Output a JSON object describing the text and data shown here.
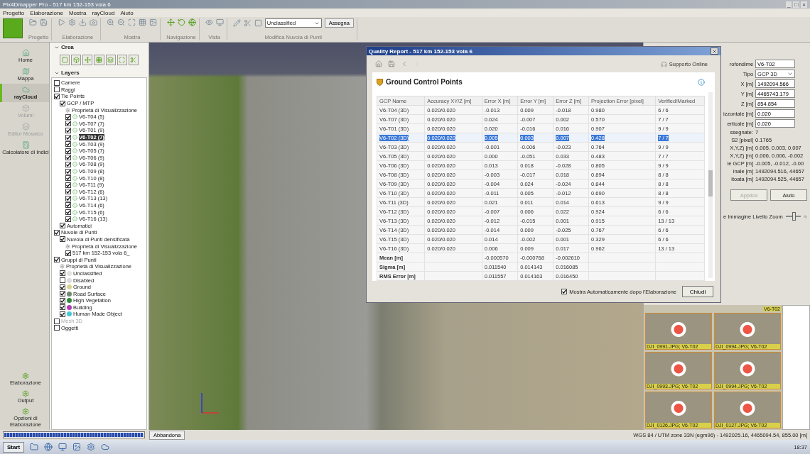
{
  "window": {
    "title": "Pix4Dmapper Pro - 517 km 152-153 vola 6",
    "controls": [
      "_",
      "□",
      "×"
    ]
  },
  "menu": [
    "Progetto",
    "Elaborazione",
    "Mostra",
    "rayCloud",
    "Aiuto"
  ],
  "toolbar": {
    "groups": [
      {
        "label": "Progetto"
      },
      {
        "label": "Elaborazione"
      },
      {
        "label": "Mostra"
      },
      {
        "label": "Navigazione"
      },
      {
        "label": "Vista"
      },
      {
        "label": "Modifica Nuvola di Punti"
      }
    ],
    "class_select": "Unclassified",
    "assign_button": "Assegna"
  },
  "nav": {
    "items": [
      {
        "label": "Home",
        "selected": false,
        "disabled": false
      },
      {
        "label": "Mappa",
        "selected": false,
        "disabled": false
      },
      {
        "label": "rayCloud",
        "selected": true,
        "disabled": false
      },
      {
        "label": "Volumi",
        "selected": false,
        "disabled": true
      },
      {
        "label": "Editor Mosaico",
        "selected": false,
        "disabled": true
      },
      {
        "label": "Calcolatore di Indici",
        "selected": false,
        "disabled": false
      }
    ],
    "bottom": [
      "Elaborazione",
      "Output",
      "Opzioni di Elaborazione"
    ]
  },
  "create": {
    "title": "Crea"
  },
  "layers": {
    "title": "Layers",
    "tree": [
      {
        "label": "Camere",
        "kind": "layer",
        "checked": false
      },
      {
        "label": "Raggi",
        "kind": "layer",
        "checked": false
      },
      {
        "label": "Tie Points",
        "kind": "layer",
        "checked": true,
        "children": [
          {
            "label": "GCP / MTP",
            "kind": "layer",
            "checked": true,
            "children": [
              {
                "label": "Proprietà di Visualizzazione",
                "kind": "props"
              },
              {
                "label": "V6-T04 (5)",
                "kind": "point",
                "checked": true,
                "selected": false
              },
              {
                "label": "V6-T07 (7)",
                "kind": "point",
                "checked": true,
                "selected": false
              },
              {
                "label": "V6-T01 (9)",
                "kind": "point",
                "checked": true,
                "selected": false
              },
              {
                "label": "V6-T02 (7)",
                "kind": "point",
                "checked": true,
                "selected": true
              },
              {
                "label": "V6-T03 (9)",
                "kind": "point",
                "checked": true,
                "selected": false
              },
              {
                "label": "V6-T05 (7)",
                "kind": "point",
                "checked": true,
                "selected": false
              },
              {
                "label": "V6-T06 (9)",
                "kind": "point",
                "checked": true,
                "selected": false
              },
              {
                "label": "V6-T08 (9)",
                "kind": "point",
                "checked": true,
                "selected": false
              },
              {
                "label": "V6-T09 (8)",
                "kind": "point",
                "checked": true,
                "selected": false
              },
              {
                "label": "V6-T10 (8)",
                "kind": "point",
                "checked": true,
                "selected": false
              },
              {
                "label": "V6-T11 (9)",
                "kind": "point",
                "checked": true,
                "selected": false
              },
              {
                "label": "V6-T12 (6)",
                "kind": "point",
                "checked": true,
                "selected": false
              },
              {
                "label": "V6-T13 (13)",
                "kind": "point",
                "checked": true,
                "selected": false
              },
              {
                "label": "V6-T14 (6)",
                "kind": "point",
                "checked": true,
                "selected": false
              },
              {
                "label": "V6-T15 (6)",
                "kind": "point",
                "checked": true,
                "selected": false
              },
              {
                "label": "V6-T16 (13)",
                "kind": "point",
                "checked": true,
                "selected": false
              }
            ]
          },
          {
            "label": "Automatici",
            "kind": "layer",
            "checked": true
          }
        ]
      },
      {
        "label": "Nuvole di Punti",
        "kind": "layer",
        "checked": true,
        "children": [
          {
            "label": "Nuvola di Punti densificata",
            "kind": "layer",
            "checked": true,
            "children": [
              {
                "label": "Proprietà di Visualizzazione",
                "kind": "props"
              },
              {
                "label": "517 km 152-153 vola 6_",
                "kind": "layer",
                "checked": true
              }
            ]
          }
        ]
      },
      {
        "label": "Gruppi di Punti",
        "kind": "layer",
        "checked": true,
        "children": [
          {
            "label": "Proprietà di Visualizzazione",
            "kind": "props"
          },
          {
            "label": "Unclassified",
            "kind": "class",
            "checked": true,
            "color": "#e4e4dc"
          },
          {
            "label": "Disabled",
            "kind": "class",
            "checked": false,
            "color": "#dcdcdc"
          },
          {
            "label": "Ground",
            "kind": "class",
            "checked": true,
            "color": "#d8d490"
          },
          {
            "label": "Road Surface",
            "kind": "class",
            "checked": true,
            "color": "#6f8a6f"
          },
          {
            "label": "High Vegetation",
            "kind": "class",
            "checked": true,
            "color": "#2f8a3a"
          },
          {
            "label": "Building",
            "kind": "class",
            "checked": true,
            "color": "#b03cb8"
          },
          {
            "label": "Human Made Object",
            "kind": "class",
            "checked": true,
            "color": "#45c8d8"
          }
        ]
      },
      {
        "label": "Mesh 3D",
        "kind": "layer",
        "checked": false,
        "disabled": true
      },
      {
        "label": "Oggetti",
        "kind": "layer",
        "checked": false,
        "disabled": false
      }
    ]
  },
  "report": {
    "title": "Quality Report - 517 km 152-153 vola 6",
    "support": "Supporto Online",
    "section": "Ground Control Points",
    "table": {
      "columns": [
        "GCP Name",
        "Accuracy XY/Z [m]",
        "Error X [m]",
        "Error Y [m]",
        "Error Z [m]",
        "Projection Error [pixel]",
        "Verified/Marked"
      ],
      "rows": [
        {
          "kind": "gcp",
          "cells": [
            "V6-T04 (3D)",
            "0.020/0.020",
            "-0.013",
            "0.009",
            "-0.018",
            "0.980",
            "6 / 6"
          ],
          "selected": false
        },
        {
          "kind": "gcp",
          "cells": [
            "V6-T07 (3D)",
            "0.020/0.020",
            "0.024",
            "-0.007",
            "0.002",
            "0.570",
            "7 / 7"
          ],
          "selected": false
        },
        {
          "kind": "gcp",
          "cells": [
            "V6-T01 (3D)",
            "0.020/0.020",
            "0.020",
            "-0.016",
            "0.016",
            "0.907",
            "9 / 9"
          ],
          "selected": false
        },
        {
          "kind": "gcp",
          "cells": [
            "V6-T02 (3D)",
            "0.020/0.020",
            "0.005",
            "0.003",
            "0.007",
            "0.428",
            "7 / 7"
          ],
          "selected": true
        },
        {
          "kind": "gcp",
          "cells": [
            "V6-T03 (3D)",
            "0.020/0.020",
            "-0.001",
            "-0.006",
            "-0.023",
            "0.764",
            "9 / 9"
          ],
          "selected": false
        },
        {
          "kind": "gcp",
          "cells": [
            "V6-T05 (3D)",
            "0.020/0.020",
            "0.000",
            "-0.051",
            "0.033",
            "0.483",
            "7 / 7"
          ],
          "selected": false
        },
        {
          "kind": "gcp",
          "cells": [
            "V6-T06 (3D)",
            "0.020/0.020",
            "0.013",
            "0.018",
            "-0.028",
            "0.805",
            "9 / 9"
          ],
          "selected": false
        },
        {
          "kind": "gcp",
          "cells": [
            "V6-T08 (3D)",
            "0.020/0.020",
            "-0.003",
            "-0.017",
            "0.018",
            "0.894",
            "8 / 8"
          ],
          "selected": false
        },
        {
          "kind": "gcp",
          "cells": [
            "V6-T09 (3D)",
            "0.020/0.020",
            "-0.004",
            "0.024",
            "-0.024",
            "0.844",
            "8 / 8"
          ],
          "selected": false
        },
        {
          "kind": "gcp",
          "cells": [
            "V6-T10 (3D)",
            "0.020/0.020",
            "-0.011",
            "0.005",
            "-0.012",
            "0.690",
            "8 / 8"
          ],
          "selected": false
        },
        {
          "kind": "gcp",
          "cells": [
            "V6-T11 (3D)",
            "0.020/0.020",
            "0.021",
            "0.011",
            "0.014",
            "0.613",
            "9 / 9"
          ],
          "selected": false
        },
        {
          "kind": "gcp",
          "cells": [
            "V6-T12 (3D)",
            "0.020/0.020",
            "-0.007",
            "0.006",
            "0.022",
            "0.924",
            "6 / 6"
          ],
          "selected": false
        },
        {
          "kind": "gcp",
          "cells": [
            "V6-T13 (3D)",
            "0.020/0.020",
            "-0.012",
            "-0.015",
            "0.001",
            "0.915",
            "13 / 13"
          ],
          "selected": false
        },
        {
          "kind": "gcp",
          "cells": [
            "V6-T14 (3D)",
            "0.020/0.020",
            "-0.014",
            "0.009",
            "-0.025",
            "0.767",
            "6 / 6"
          ],
          "selected": false
        },
        {
          "kind": "gcp",
          "cells": [
            "V6-T15 (3D)",
            "0.020/0.020",
            "0.014",
            "-0.002",
            "0.001",
            "0.329",
            "6 / 6"
          ],
          "selected": false
        },
        {
          "kind": "gcp",
          "cells": [
            "V6-T16 (3D)",
            "0.020/0.020",
            "0.006",
            "0.009",
            "0.017",
            "0.962",
            "13 / 13"
          ],
          "selected": false
        },
        {
          "kind": "summary",
          "cells": [
            "Mean [m]",
            "-0.000570",
            "-0.000768",
            "-0.002610"
          ],
          "selected": false
        },
        {
          "kind": "summary",
          "cells": [
            "Sigma [m]",
            "0.011540",
            "0.014143",
            "0.016085"
          ],
          "selected": false
        },
        {
          "kind": "summary",
          "cells": [
            "RMS Error [m]",
            "0.011557",
            "0.014163",
            "0.016450"
          ],
          "selected": false
        }
      ]
    },
    "auto_show": {
      "label": "Mostra Automaticamente dopo l'Elaborazione",
      "checked": true
    },
    "close_button": "Chiudi"
  },
  "properties": {
    "fields": [
      {
        "label": "rofondime",
        "kind": "input",
        "value": "V6-T02"
      },
      {
        "label": "Tipo",
        "kind": "select",
        "value": "GCP 3D"
      },
      {
        "label": "X [m]",
        "kind": "input",
        "value": "1492094.566"
      },
      {
        "label": "Y [m]",
        "kind": "input",
        "value": "4465743.179"
      },
      {
        "label": "Z [m]",
        "kind": "input",
        "value": "854.854"
      },
      {
        "label": "izzontale [m]",
        "kind": "input",
        "value": "0.020"
      },
      {
        "label": "erticale [m]",
        "kind": "input",
        "value": "0.020"
      },
      {
        "label": "ssegnate:",
        "kind": "text",
        "value": "7"
      },
      {
        "label": "S2 [pixel]",
        "kind": "text",
        "value": "0.1765"
      },
      {
        "label": "X,Y,Z) [m]",
        "kind": "text",
        "value": "0.005, 0.003, 0.007"
      },
      {
        "label": "X,Y,Z) [m]",
        "kind": "text",
        "value": "0.006, 0.006, -0.002"
      },
      {
        "label": "le GCP [m]",
        "kind": "text",
        "value": "-0.005, -0.012, -0.00"
      },
      {
        "label": "inale [m]",
        "kind": "text",
        "value": "1492094.516, 44657"
      },
      {
        "label": "itoata [m]",
        "kind": "text",
        "value": "1492094.525, 44657"
      }
    ],
    "buttons": [
      {
        "label": "Applica",
        "disabled": true
      },
      {
        "label": "Aiuto",
        "disabled": false
      }
    ],
    "zoom_label": "e Immagine Livello Zoom",
    "zoom": {
      "level": 0.55
    }
  },
  "thumbnail_strip_caption": "V6-T02",
  "thumbnails": [
    {
      "caption": "DJI_0991.JPG; V6-T02"
    },
    {
      "caption": "DJI_0994.JPG; V6-T02"
    },
    {
      "caption": "DJI_0993.JPG; V6-T02"
    },
    {
      "caption": "DJI_0994.JPG; V6-T02"
    },
    {
      "caption": "DJI_0126.JPG; V6-T02"
    },
    {
      "caption": "DJI_0127.JPG; V6-T02"
    }
  ],
  "status": {
    "progress": {
      "level": 1
    },
    "cancel_button": "Abbandona",
    "coords": "WGS 84 / UTM zone 33N (egm96) - 1492025.16, 4465094.54, 855.00 [m]"
  },
  "taskbar": {
    "start": "Start",
    "clock": "18:37"
  }
}
